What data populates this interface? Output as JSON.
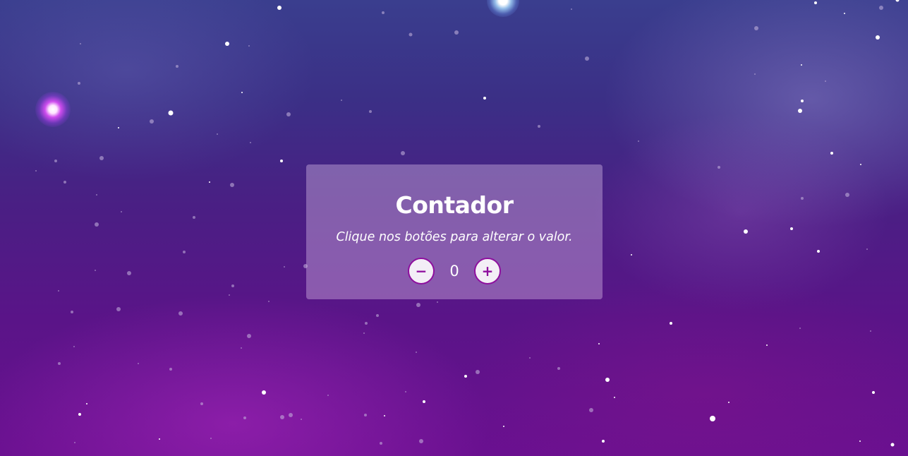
{
  "counter": {
    "title": "Contador",
    "subtitle": "Clique nos botões para alterar o valor.",
    "decrement_label": "−",
    "increment_label": "+",
    "value": "0"
  },
  "colors": {
    "accent": "#8e0f9e",
    "button_bg": "#f3eef6",
    "text": "#ffffff"
  },
  "icons": {
    "decrement": "minus-icon",
    "increment": "plus-icon"
  }
}
